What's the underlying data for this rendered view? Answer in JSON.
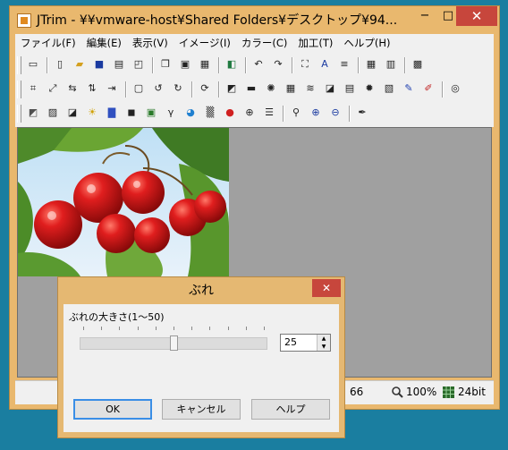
{
  "window": {
    "title": "JTrim - ¥¥vmware-host¥Shared Folders¥デスクトップ¥94...",
    "minimize": "−",
    "maximize": "□",
    "close": "✕"
  },
  "menu": [
    "ファイル(F)",
    "編集(E)",
    "表示(V)",
    "イメージ(I)",
    "カラー(C)",
    "加工(T)",
    "ヘルプ(H)"
  ],
  "status": {
    "partial": "66",
    "zoom": "100%",
    "depth": "24bit"
  },
  "dialog": {
    "title": "ぶれ",
    "close": "✕",
    "label": "ぶれの大きさ(1〜50)",
    "value": "25",
    "slider_fraction": 0.5,
    "ok": "OK",
    "cancel": "キャンセル",
    "help": "ヘルプ"
  },
  "colors": {
    "frame": "#e9b86e",
    "desktop": "#1a7ea0",
    "close": "#c7463c",
    "workspace": "#a0a0a0"
  },
  "toolbar_icons": {
    "row1": [
      "new-window-icon",
      "new-file-icon",
      "open-folder-icon",
      "save-icon",
      "print-icon",
      "print-preview-icon",
      "copy-icon",
      "paste-icon",
      "paste-new-icon",
      "capture-icon",
      "undo-icon",
      "redo-icon",
      "fit-window-icon",
      "text-icon",
      "stripe-icon",
      "grid-view-icon",
      "filmstrip-icon",
      "palette-grid-icon"
    ],
    "row2": [
      "crop-icon",
      "resize-icon",
      "flip-horizontal-icon",
      "flip-vertical-icon",
      "move-icon",
      "frame-icon",
      "rotate-left-90-icon",
      "rotate-right-90-icon",
      "rotate-free-icon",
      "shadow-icon",
      "flat-button-icon",
      "sparkle-icon",
      "mosaic-icon",
      "wave-icon",
      "emboss-icon",
      "brick-icon",
      "burst-icon",
      "tile-icon",
      "pen-icon",
      "highlight-icon",
      "spiral-icon"
    ],
    "row3": [
      "gradient-icon",
      "sepia-icon",
      "contrast-icon",
      "sun-icon",
      "histogram-icon",
      "levels-icon",
      "picture-icon",
      "gamma-icon",
      "color-wheel-icon",
      "noise-icon",
      "rgb-icon",
      "xor-icon",
      "scanline-icon",
      "zoom-menu-icon",
      "zoom-in-icon",
      "zoom-out-icon",
      "eyedropper-icon"
    ]
  }
}
